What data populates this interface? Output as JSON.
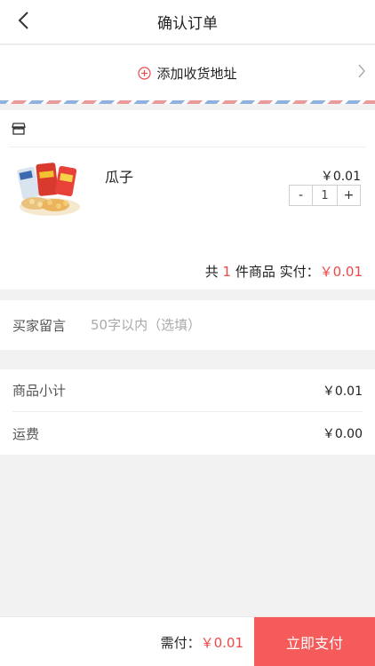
{
  "navbar": {
    "title": "确认订单",
    "back_icon": "chevron-left-icon"
  },
  "address": {
    "label": "添加收货地址",
    "icon": "plus-circle-icon",
    "accent_color": "#f04848"
  },
  "shop": {
    "icon": "store-icon",
    "product": {
      "name": "瓜子",
      "price": "￥0.01",
      "quantity": "1",
      "minus_label": "-",
      "plus_label": "+",
      "image_icon": "snack-bags-image"
    },
    "summary": {
      "prefix": "共",
      "count": "1",
      "middle": "件商品 实付：",
      "amount": "￥0.01"
    }
  },
  "remark": {
    "label": "买家留言",
    "placeholder": "50字以内（选填）",
    "value": ""
  },
  "totals": {
    "subtotal_label": "商品小计",
    "subtotal_value": "￥0.01",
    "shipping_label": "运费",
    "shipping_value": "￥0.00"
  },
  "footer": {
    "due_label": "需付：",
    "due_amount": "￥0.01",
    "pay_button": "立即支付",
    "pay_color": "#f55b5b"
  }
}
